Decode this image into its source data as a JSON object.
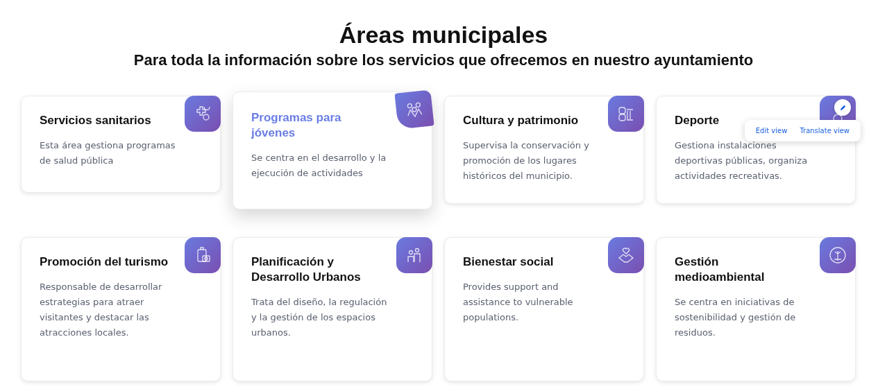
{
  "header": {
    "title": "Áreas municipales",
    "subtitle": "Para toda la información sobre los servicios que ofrecemos en nuestro ayuntamiento"
  },
  "cards": [
    {
      "title": "Servicios sanitarios",
      "text": "Esta área gestiona programas de salud pública",
      "kind": "medical",
      "highlighted": false
    },
    {
      "title": "Programas para jóvenes",
      "text": "Se centra en el desarrollo y la ejecución de actividades",
      "kind": "youth",
      "highlighted": true
    },
    {
      "title": "Cultura y patrimonio",
      "text": "Supervisa la conservación y promoción de los lugares históricos del municipio.",
      "kind": "theater",
      "highlighted": false
    },
    {
      "title": "Deporte",
      "text": "Gestiona instalaciones deportivas públicas, organiza actividades recreativas.",
      "kind": "sports",
      "highlighted": false,
      "menu": {
        "items": [
          "Edit view",
          "Translate view"
        ]
      }
    },
    {
      "title": "Promoción del turismo",
      "text": "Responsable de desarrollar estrategias para atraer visitantes y destacar las atracciones locales.",
      "kind": "luggage",
      "highlighted": false
    },
    {
      "title": "Planificación y Desarrollo Urbanos",
      "text": "Trata del diseño, la regulación y la gestión de los espacios urbanos.",
      "kind": "people",
      "highlighted": false
    },
    {
      "title": "Bienestar social",
      "text": "Provides support and assistance to vulnerable populations.",
      "kind": "handheart",
      "highlighted": false
    },
    {
      "title": "Gestión medioambiental",
      "text": "Se centra en iniciativas de sostenibilidad y gestión de residuos.",
      "kind": "plant",
      "highlighted": false
    }
  ]
}
